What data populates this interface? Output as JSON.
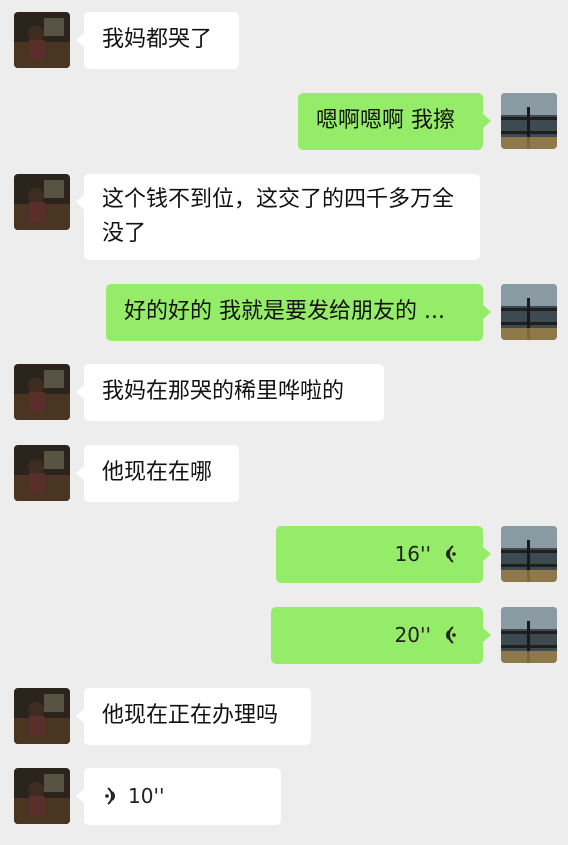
{
  "messages": [
    {
      "side": "left",
      "type": "text",
      "text": "我妈都哭了"
    },
    {
      "side": "right",
      "type": "text",
      "text": "嗯啊嗯啊 我擦"
    },
    {
      "side": "left",
      "type": "text",
      "text": "这个钱不到位，这交了的四千多万全没了"
    },
    {
      "side": "right",
      "type": "text",
      "text": "好的好的 我就是要发给朋友的 ..."
    },
    {
      "side": "left",
      "type": "text",
      "text": "我妈在那哭的稀里哗啦的"
    },
    {
      "side": "left",
      "type": "text",
      "text": "他现在在哪"
    },
    {
      "side": "right",
      "type": "voice",
      "duration": "16''",
      "icon": "voice-wave-icon"
    },
    {
      "side": "right",
      "type": "voice",
      "duration": "20''",
      "icon": "voice-wave-icon"
    },
    {
      "side": "left",
      "type": "text",
      "text": "他现在正在办理吗"
    },
    {
      "side": "left",
      "type": "voice",
      "duration": "10''",
      "icon": "voice-wave-icon"
    }
  ],
  "colors": {
    "background": "#ededed",
    "incoming_bubble": "#ffffff",
    "outgoing_bubble": "#95ec69"
  }
}
